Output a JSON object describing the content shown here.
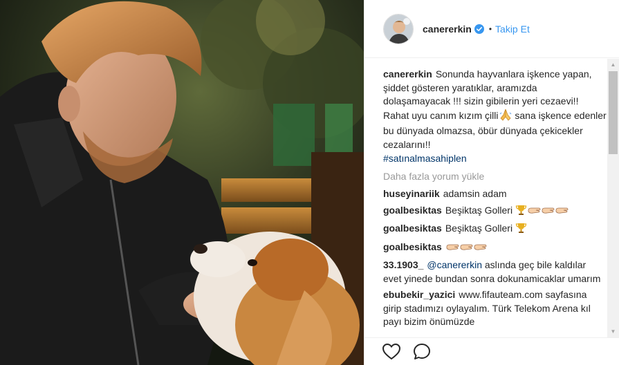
{
  "post": {
    "author": {
      "username": "canererkin",
      "verified": true
    },
    "separator": "•",
    "follow_label": "Takip Et",
    "caption": {
      "username": "canererkin",
      "text": "Sonunda hayvanlara işkence yapan, şiddet gösteren yaratıklar, aramızda dolaşamayacak !!! sizin gibilerin yeri cezaevi!! Rahat uyu canım kızım çilli",
      "text_after_emoji": " sana işkence edenler bu dünyada olmazsa, öbür dünyada çekicekler cezalarını!!",
      "hashtag": "#satınalmasahiplen"
    },
    "load_more_label": "Daha fazla yorum yükle",
    "comments": [
      {
        "username": "huseyinariik",
        "text": "adamsin adam",
        "emoji": []
      },
      {
        "username": "goalbesiktas",
        "text": "Beşiktaş Golleri",
        "emoji": [
          "trophy-icon",
          "clap-icon",
          "clap-icon",
          "clap-icon"
        ]
      },
      {
        "username": "goalbesiktas",
        "text": "Beşiktaş Golleri",
        "emoji": [
          "trophy-icon"
        ]
      },
      {
        "username": "goalbesiktas",
        "text": "",
        "emoji": [
          "clap-icon",
          "clap-icon",
          "clap-icon"
        ]
      },
      {
        "username": "33.1903_",
        "mention": "@canererkin",
        "text": "aslında geç bile kaldılar evet yinede bundan sonra dokunamicaklar umarım",
        "emoji": []
      },
      {
        "username": "ebubekir_yazici",
        "text": "www.fifauteam.com sayfasına girip stadımızı oylayalım. Türk Telekom Arena kıl payı bizim önümüzde",
        "emoji": []
      }
    ],
    "actions": {
      "like_icon": "heart-icon",
      "comment_icon": "comment-icon"
    }
  },
  "colors": {
    "accent": "#3897f0",
    "verified": "#3897f0",
    "text": "#262626",
    "muted": "#999999",
    "link": "#003569"
  }
}
